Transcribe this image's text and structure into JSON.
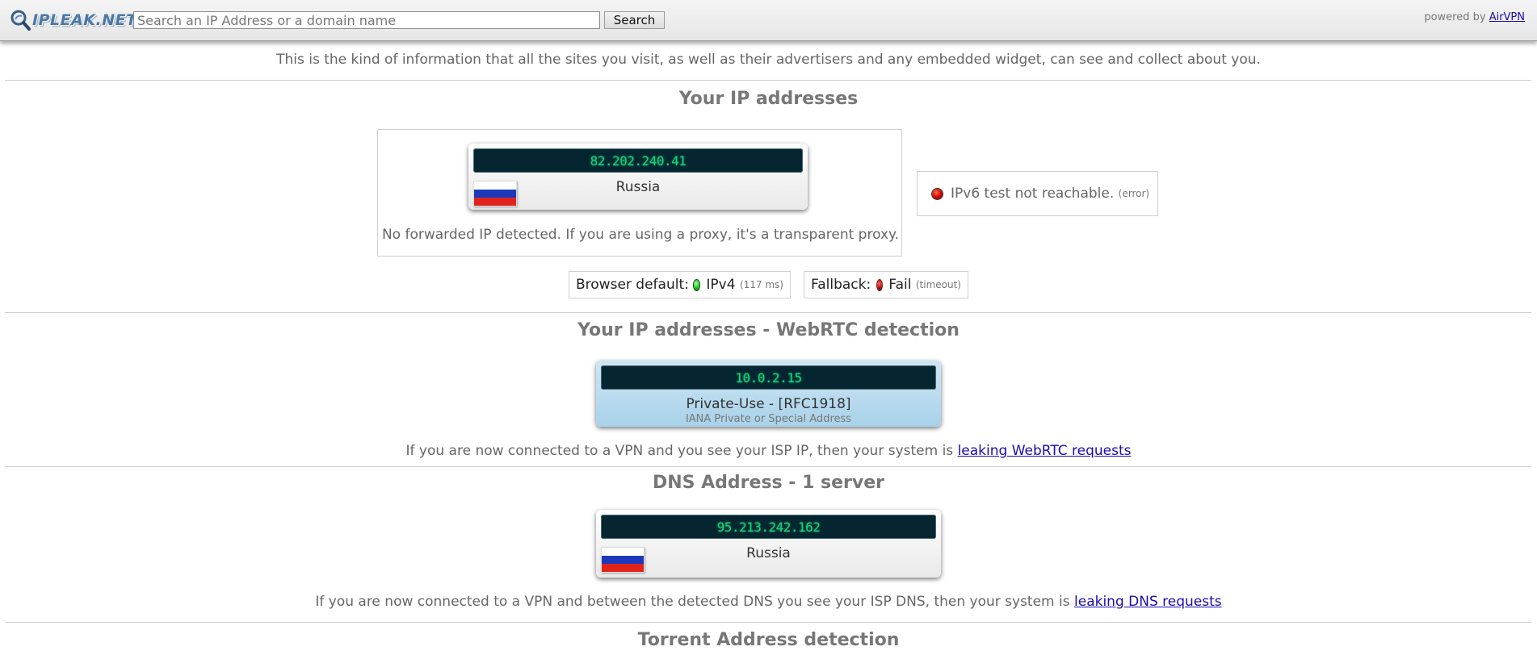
{
  "header": {
    "logo_text": "IPLEAK.NET",
    "search_placeholder": "Search an IP Address or a domain name",
    "search_button": "Search",
    "powered_by": "powered by",
    "powered_link": "AirVPN"
  },
  "intro": "This is the kind of information that all the sites you visit, as well as their advertisers and any embedded widget, can see and collect about you.",
  "ip_section": {
    "title": "Your IP addresses",
    "ipv4": {
      "address": "82.202.240.41",
      "country": "Russia",
      "flag_colors": [
        "#ffffff",
        "#1c39bb",
        "#e0241c"
      ]
    },
    "forwarded_note": "No forwarded IP detected. If you are using a proxy, it's a transparent proxy.",
    "ipv6_status": "IPv6 test not reachable.",
    "ipv6_note": "(error)",
    "browser_default_label": "Browser default:",
    "browser_default_value": "IPv4",
    "browser_default_note": "(117 ms)",
    "fallback_label": "Fallback:",
    "fallback_value": "Fail",
    "fallback_note": "(timeout)"
  },
  "webrtc_section": {
    "title": "Your IP addresses - WebRTC detection",
    "address": "10.0.2.15",
    "label": "Private-Use - [RFC1918]",
    "sublabel": "IANA Private or Special Address",
    "note_prefix": "If you are now connected to a VPN and you see your ISP IP, then your system is",
    "note_link": "leaking WebRTC requests"
  },
  "dns_section": {
    "title": "DNS Address - 1 server",
    "address": "95.213.242.162",
    "country": "Russia",
    "note_prefix": "If you are now connected to a VPN and between the detected DNS you see your ISP DNS, then your system is",
    "note_link": "leaking DNS requests"
  },
  "torrent_section": {
    "title": "Torrent Address detection"
  }
}
